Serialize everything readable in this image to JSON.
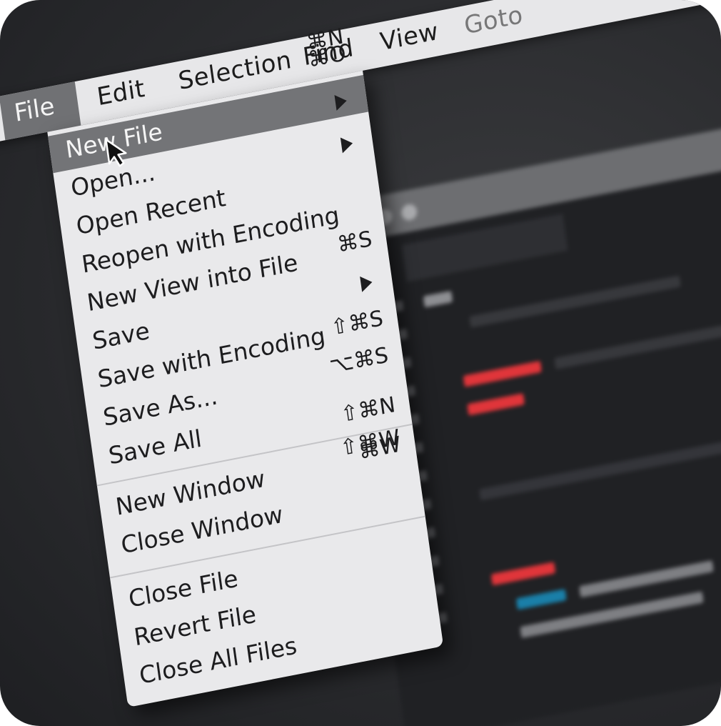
{
  "menubar": {
    "items": [
      {
        "label": "File"
      },
      {
        "label": "Edit"
      },
      {
        "label": "Selection"
      },
      {
        "label": "Find"
      },
      {
        "label": "View"
      },
      {
        "label": "Goto"
      }
    ]
  },
  "file_menu": {
    "top_shortcut": "⌘N",
    "items": [
      {
        "label": "New File",
        "shortcut": "⌘O"
      },
      {
        "label": "Open...",
        "shortcut": ""
      },
      {
        "label": "Open Recent",
        "shortcut": ""
      },
      {
        "label": "Reopen with Encoding",
        "shortcut": ""
      },
      {
        "label": "New View into File",
        "shortcut": "⌘S"
      },
      {
        "label": "Save",
        "shortcut": ""
      },
      {
        "label": "Save with Encoding",
        "shortcut": "⇧⌘S"
      },
      {
        "label": "Save As...",
        "shortcut": "⌥⌘S"
      },
      {
        "label": "Save All",
        "shortcut": ""
      },
      {
        "label": "New Window",
        "shortcut": "⇧⌘N"
      },
      {
        "label": "Close Window",
        "shortcut": "⇧⌘W"
      },
      {
        "label": "Close File",
        "shortcut": "⌘W"
      },
      {
        "label": "Revert File",
        "shortcut": ""
      },
      {
        "label": "Close All Files",
        "shortcut": ""
      }
    ]
  },
  "colors": {
    "menu_background": "#e9e9eb",
    "menu_highlight": "#737477",
    "editor_background": "#202124",
    "code_accent_red": "#e0353a",
    "code_accent_blue": "#1a7fa8",
    "code_accent_purple": "#6a5bd6"
  },
  "icons": {
    "submenu": "triangle-right-icon",
    "pointer": "mouse-cursor-icon"
  }
}
